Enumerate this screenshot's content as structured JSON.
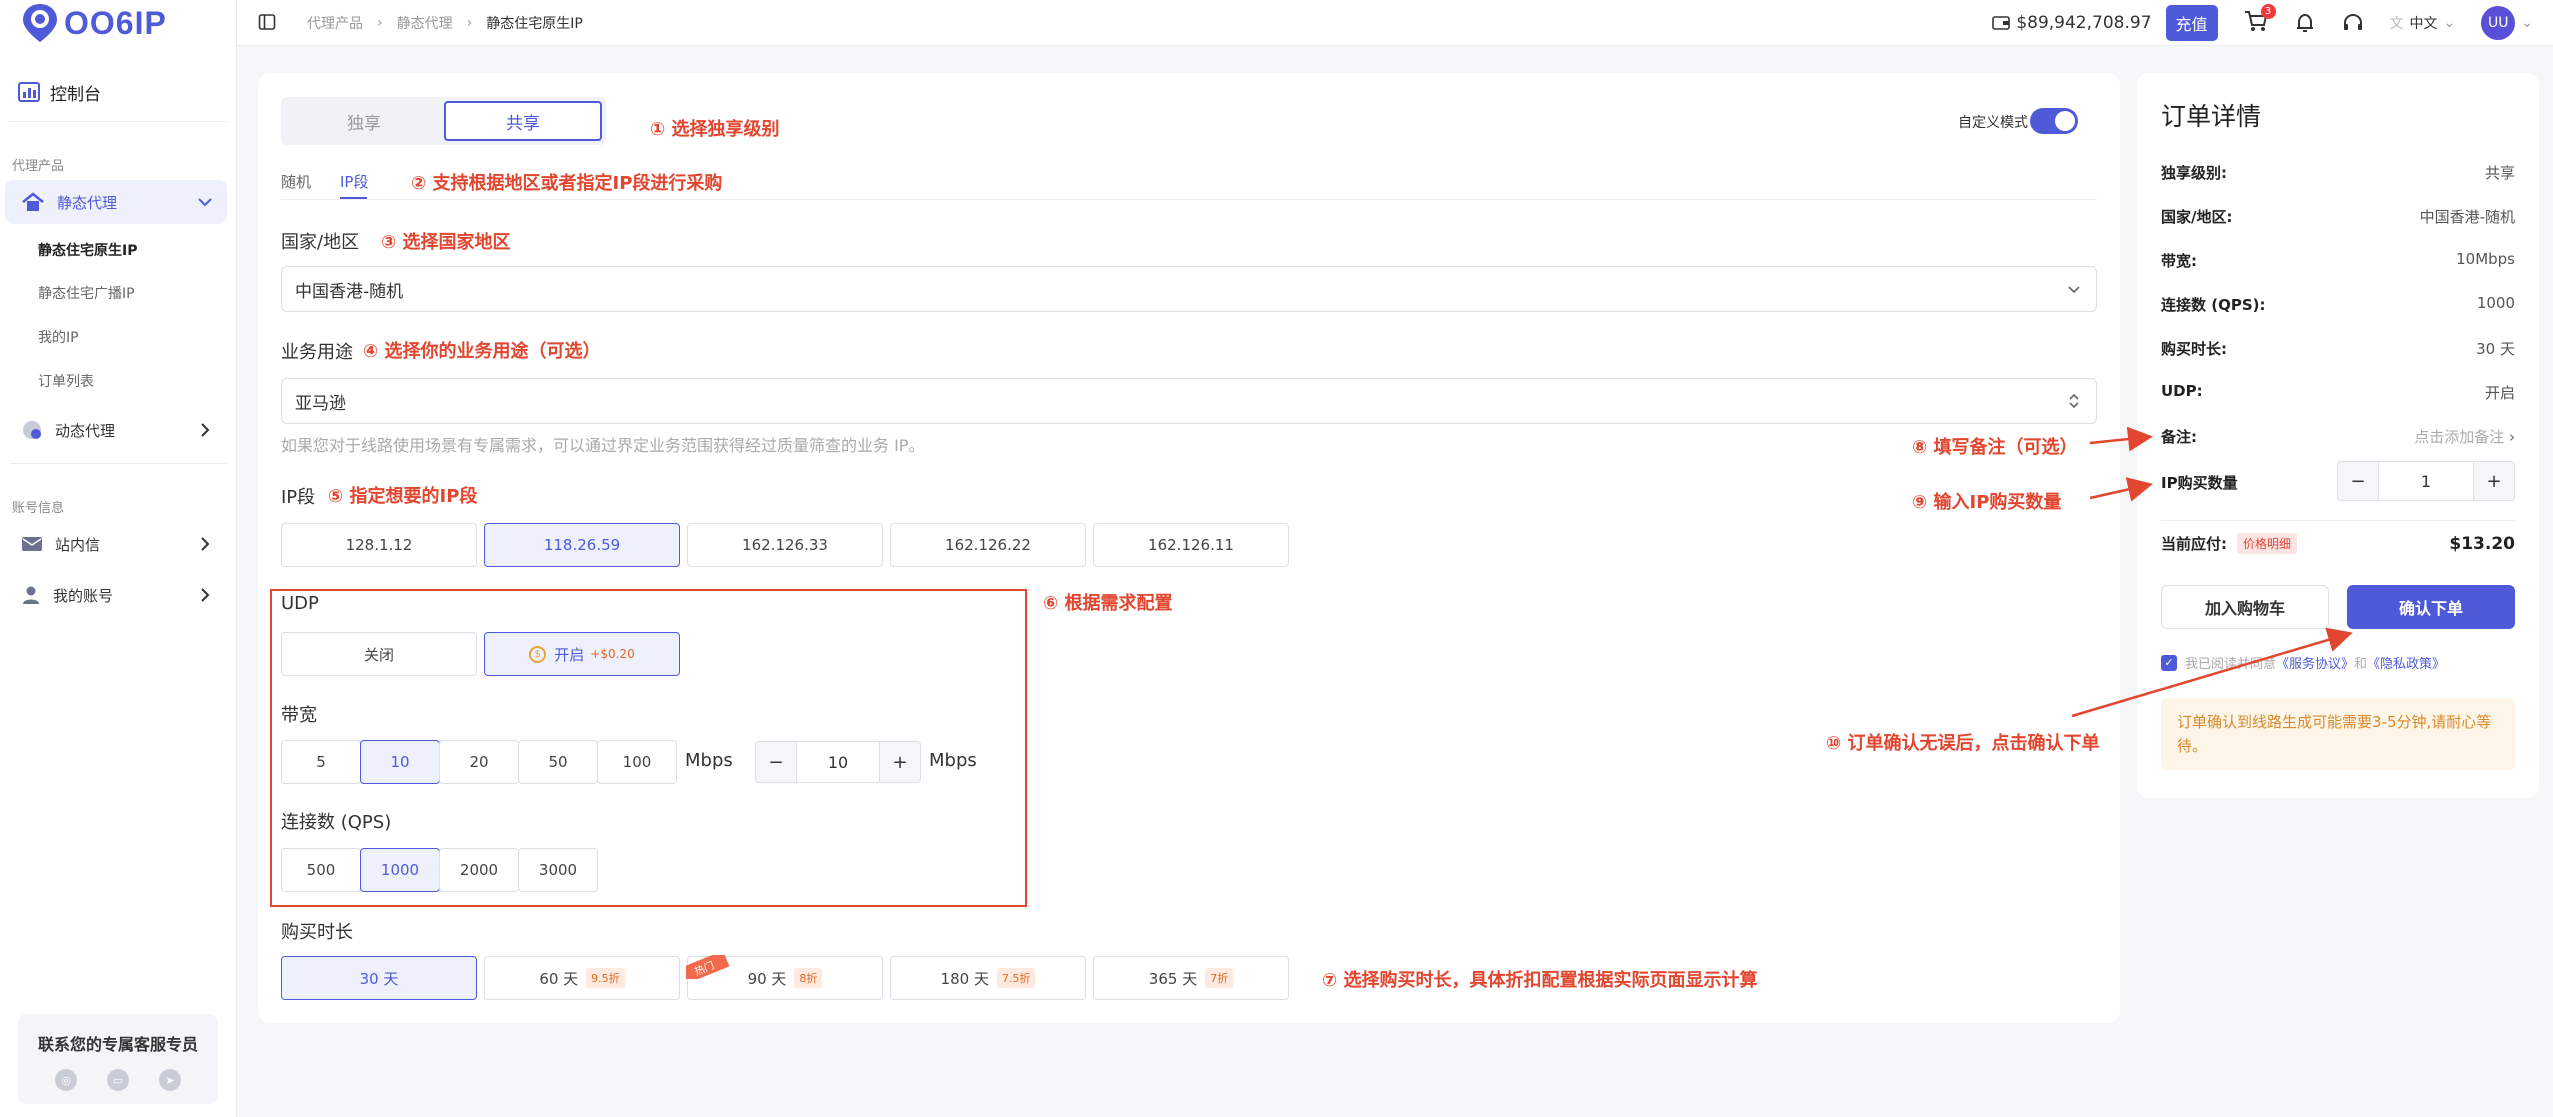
{
  "brand": {
    "logo_text": "OO6IP",
    "accent": "#4f5ad8",
    "annotation_color": "#e2462f"
  },
  "sidebar": {
    "dashboard": "控制台",
    "group_proxy": "代理产品",
    "static_proxy": "静态代理",
    "static_sub": [
      "静态住宅原生IP",
      "静态住宅广播IP",
      "我的IP",
      "订单列表"
    ],
    "dynamic_proxy": "动态代理",
    "group_account": "账号信息",
    "messages": "站内信",
    "my_account": "我的账号",
    "support_title": "联系您的专属客服专员"
  },
  "topbar": {
    "breadcrumb": [
      "代理产品",
      "静态代理",
      "静态住宅原生IP"
    ],
    "balance": "$89,942,708.97",
    "recharge": "充值",
    "cart_count": "3",
    "language": "中文",
    "avatar": "UU"
  },
  "form": {
    "level_options": [
      "独享",
      "共享"
    ],
    "custom_mode": "自定义模式",
    "tabs": [
      "随机",
      "IP段"
    ],
    "country_label": "国家/地区",
    "country_value": "中国香港-随机",
    "usage_label": "业务用途",
    "usage_value": "亚马逊",
    "usage_hint": "如果您对于线路使用场景有专属需求，可以通过界定业务范围获得经过质量筛查的业务 IP。",
    "ip_label": "IP段",
    "ip_segments": [
      "128.1.12",
      "118.26.59",
      "162.126.33",
      "162.126.22",
      "162.126.11"
    ],
    "udp_label": "UDP",
    "udp_off": "关闭",
    "udp_on": "开启",
    "udp_price": "+$0.20",
    "bw_label": "带宽",
    "bw_options": [
      "5",
      "10",
      "20",
      "50",
      "100"
    ],
    "bw_unit": "Mbps",
    "bw_custom_value": "10",
    "qps_label": "连接数 (QPS)",
    "qps_options": [
      "500",
      "1000",
      "2000",
      "3000"
    ],
    "duration_label": "购买时长",
    "durations": [
      {
        "label": "30 天",
        "discount": ""
      },
      {
        "label": "60 天",
        "discount": "9.5折"
      },
      {
        "label": "90 天",
        "discount": "8折"
      },
      {
        "label": "180 天",
        "discount": "7.5折"
      },
      {
        "label": "365 天",
        "discount": "7折"
      }
    ],
    "hot_tag": "热门",
    "minus": "−",
    "plus": "+"
  },
  "annotations": {
    "a1": "① 选择独享级别",
    "a2": "② 支持根据地区或者指定IP段进行采购",
    "a3": "③ 选择国家地区",
    "a4": "④ 选择你的业务用途（可选）",
    "a5": "⑤ 指定想要的IP段",
    "a6": "⑥ 根据需求配置",
    "a7": "⑦ 选择购买时长，具体折扣配置根据实际页面显示计算",
    "a8": "⑧ 填写备注（可选）",
    "a9": "⑨ 输入IP购买数量",
    "a10": "⑩ 订单确认无误后，点击确认下单"
  },
  "order": {
    "title": "订单详情",
    "rows": [
      {
        "key": "独享级别:",
        "value": "共享"
      },
      {
        "key": "国家/地区:",
        "value": "中国香港-随机"
      },
      {
        "key": "带宽:",
        "value": "10Mbps"
      },
      {
        "key": "连接数 (QPS):",
        "value": "1000"
      },
      {
        "key": "购买时长:",
        "value": "30 天"
      },
      {
        "key": "UDP:",
        "value": "开启"
      }
    ],
    "note_key": "备注:",
    "note_placeholder": "点击添加备注",
    "qty_key": "IP购买数量",
    "qty_value": "1",
    "total_key": "当前应付:",
    "price_detail": "价格明细",
    "total_value": "$13.20",
    "add_cart": "加入购物车",
    "confirm": "确认下单",
    "agree_prefix": "我已阅读并同意",
    "terms": "《服务协议》",
    "and": "和",
    "privacy": "《隐私政策》",
    "notice": "订单确认到线路生成可能需要3-5分钟,请耐心等待。"
  }
}
